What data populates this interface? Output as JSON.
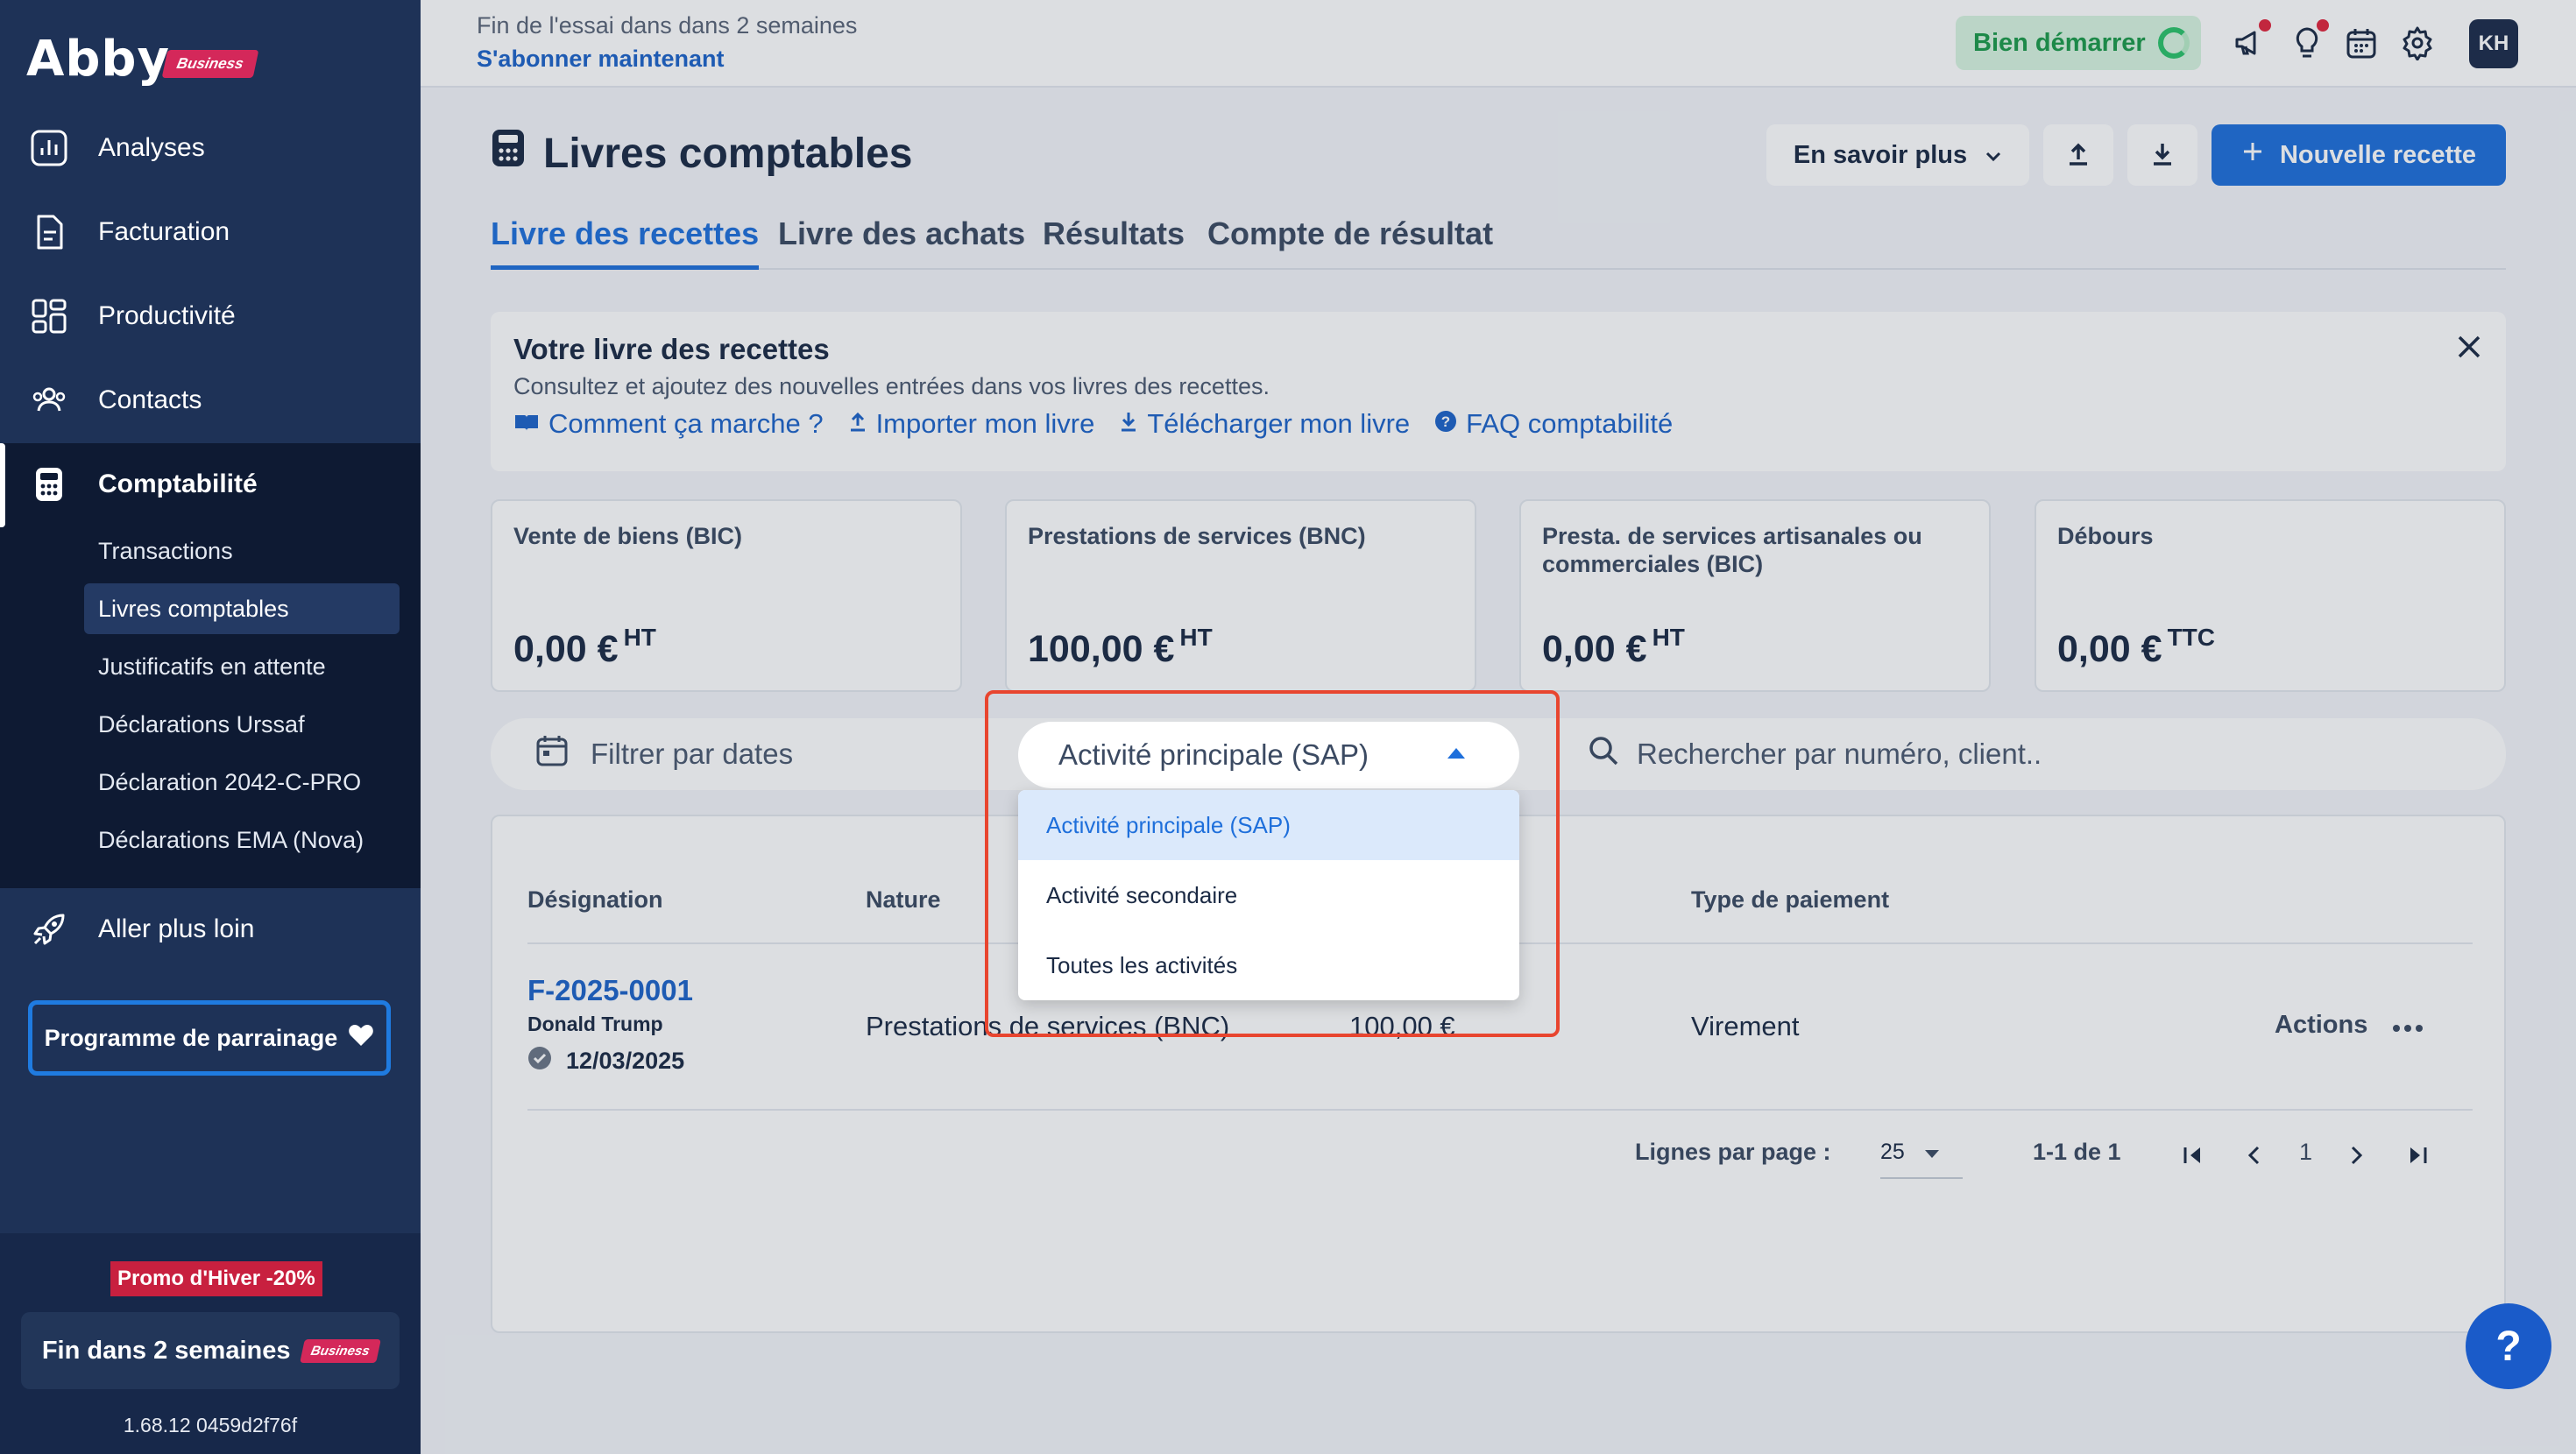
{
  "app": {
    "logo_text": "Abby",
    "logo_badge": "Business"
  },
  "sidebar": {
    "items": [
      {
        "label": "Analyses",
        "icon": "chart-icon"
      },
      {
        "label": "Facturation",
        "icon": "document-icon"
      },
      {
        "label": "Productivité",
        "icon": "grid-icon"
      },
      {
        "label": "Contacts",
        "icon": "users-icon"
      },
      {
        "label": "Comptabilité",
        "icon": "calculator-icon"
      },
      {
        "label": "Aller plus loin",
        "icon": "rocket-icon"
      }
    ],
    "sub_items": [
      {
        "label": "Transactions"
      },
      {
        "label": "Livres comptables"
      },
      {
        "label": "Justificatifs en attente"
      },
      {
        "label": "Déclarations Urssaf"
      },
      {
        "label": "Déclaration 2042-C-PRO"
      },
      {
        "label": "Déclarations EMA (Nova)"
      }
    ],
    "referral": "Programme de parrainage",
    "promo": "Promo d'Hiver -20%",
    "trial_end": "Fin dans 2 semaines",
    "trial_badge": "Business",
    "version": "1.68.12 0459d2f76f"
  },
  "topbar": {
    "trial_text": "Fin de l'essai dans dans 2 semaines",
    "subscribe": "S'abonner maintenant",
    "start_button": "Bien démarrer",
    "avatar": "KH"
  },
  "page": {
    "title": "Livres comptables",
    "learn_more": "En savoir plus",
    "new_button": "Nouvelle recette",
    "tabs": [
      {
        "label": "Livre des recettes"
      },
      {
        "label": "Livre des achats"
      },
      {
        "label": "Résultats"
      },
      {
        "label": "Compte de résultat"
      }
    ]
  },
  "info": {
    "title": "Votre livre des recettes",
    "description": "Consultez et ajoutez des nouvelles entrées dans vos livres des recettes.",
    "links": [
      {
        "label": "Comment ça marche ?"
      },
      {
        "label": "Importer mon livre"
      },
      {
        "label": "Télécharger mon livre"
      },
      {
        "label": "FAQ comptabilité"
      }
    ]
  },
  "stats": [
    {
      "label": "Vente de biens (BIC)",
      "value": "0,00 €",
      "suffix": "HT"
    },
    {
      "label": "Prestations de services (BNC)",
      "value": "100,00 €",
      "suffix": "HT"
    },
    {
      "label": "Presta. de services artisanales ou commerciales (BIC)",
      "value": "0,00 €",
      "suffix": "HT"
    },
    {
      "label": "Débours",
      "value": "0,00 €",
      "suffix": "TTC"
    }
  ],
  "filters": {
    "dates": "Filtrer par dates",
    "search_placeholder": "Rechercher par numéro, client..",
    "activity_selected": "Activité principale (SAP)",
    "activity_options": [
      {
        "label": "Activité principale (SAP)"
      },
      {
        "label": "Activité secondaire"
      },
      {
        "label": "Toutes les activités"
      }
    ]
  },
  "table": {
    "headers": {
      "designation": "Désignation",
      "nature": "Nature",
      "payment": "Type de paiement"
    },
    "rows": [
      {
        "number": "F-2025-0001",
        "client": "Donald Trump",
        "date": "12/03/2025",
        "nature": "Prestations de services (BNC)",
        "amount": "100,00 €",
        "payment": "Virement",
        "actions": "Actions"
      }
    ],
    "pagination": {
      "rows_per_page_label": "Lignes par page :",
      "rows_per_page": "25",
      "range": "1-1 de 1",
      "page": "1"
    }
  },
  "help": "?"
}
